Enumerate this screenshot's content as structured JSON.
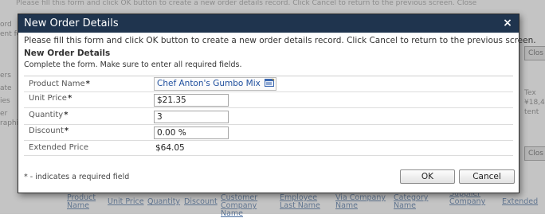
{
  "background": {
    "topline": "Please fill this form and click OK button to create a new order details record. Click Cancel to return to the previous screen.  Close",
    "left_fragments": [
      "ord",
      "ent fo",
      "ers",
      "ate",
      "ies",
      "er",
      "raphi"
    ],
    "right_buttons": [
      "Clos",
      "Clos",
      "Clos"
    ],
    "right_texts": [
      "Tex",
      "¥18,4",
      "tent"
    ],
    "column_headers": [
      "Product\nName",
      "Unit Price",
      "Quantity",
      "Discount",
      "Customer\nCompany\nName",
      "Employee\nLast Name",
      "Via Company\nName",
      "Category\nName",
      "Supplier\nCompany",
      "Extended"
    ]
  },
  "dialog": {
    "title": "New Order Details",
    "close_glyph": "×",
    "instructions": "Please fill this form and click OK button to create a new order details record. Click Cancel to return to the previous screen.",
    "section_title": "New Order Details",
    "section_description": "Complete the form. Make sure to enter all required fields.",
    "required_marker": "*",
    "fields": {
      "product_name": {
        "label": "Product Name",
        "value": "Chef Anton's Gumbo Mix"
      },
      "unit_price": {
        "label": "Unit Price",
        "value": "$21.35"
      },
      "quantity": {
        "label": "Quantity",
        "value": "3"
      },
      "discount": {
        "label": "Discount",
        "value": "0.00 %"
      },
      "extended_price": {
        "label": "Extended Price",
        "value": "$64.05"
      }
    },
    "required_note": "* - indicates a required field",
    "ok_label": "OK",
    "cancel_label": "Cancel"
  },
  "colors": {
    "titlebar": "#1f344e",
    "link": "#1f4f9e",
    "overlay": "rgba(125,125,125,0.45)"
  },
  "icons": [
    "pencil-icon",
    "lookup-list-icon",
    "close-icon"
  ]
}
